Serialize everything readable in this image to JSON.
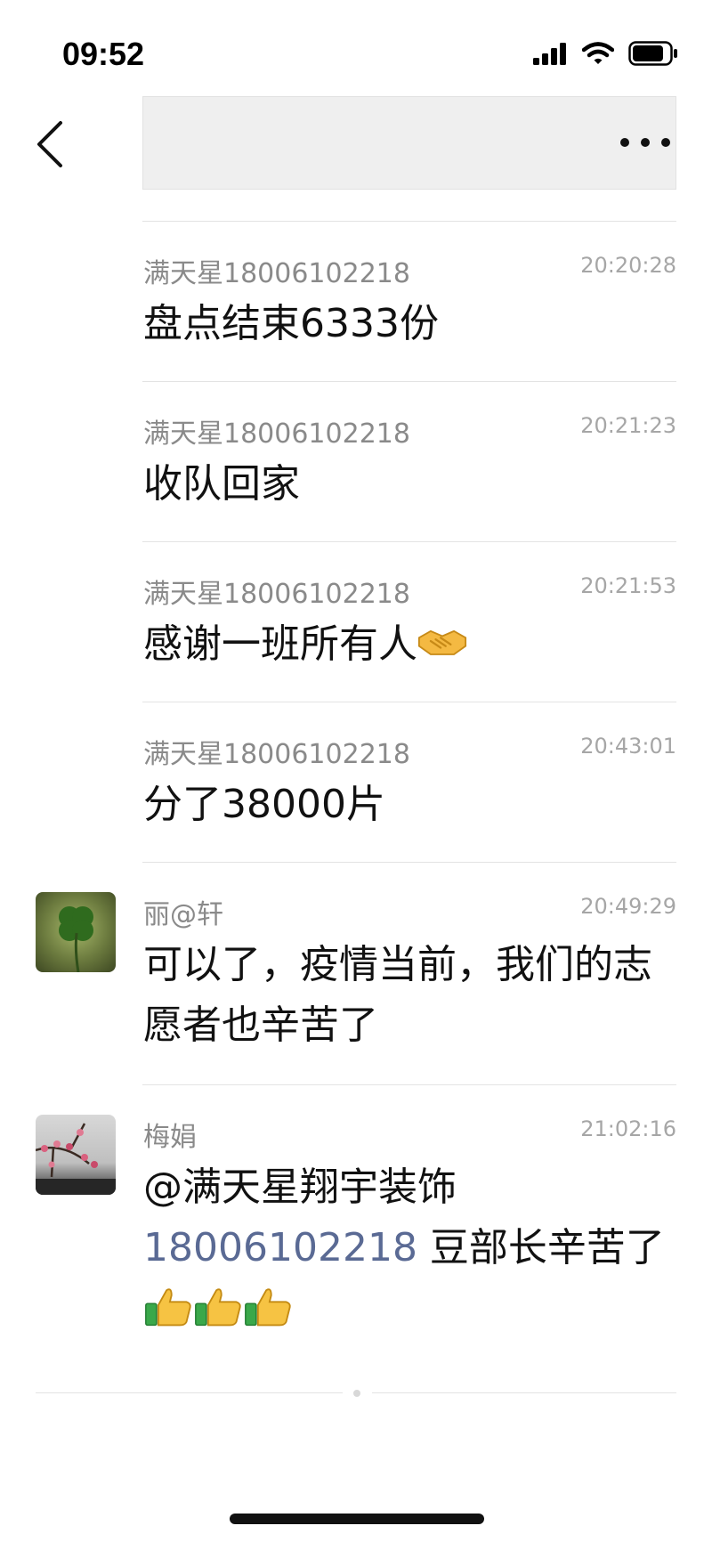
{
  "status_bar": {
    "time": "09:52",
    "battery_level": 0.85
  },
  "header": {
    "back_icon": "chevron-left-icon",
    "more_icon": "ellipsis-icon"
  },
  "messages": [
    {
      "sender": "满天星18006102218",
      "time": "20:20:28",
      "text": "盘点结束6333份"
    },
    {
      "sender": "满天星18006102218",
      "time": "20:21:23",
      "text": "收队回家"
    },
    {
      "sender": "满天星18006102218",
      "time": "20:21:53",
      "text": "感谢一班所有人",
      "emoji": "handshake-emoji"
    },
    {
      "sender": "满天星18006102218",
      "time": "20:43:01",
      "text": "分了38000片"
    },
    {
      "sender": "丽@轩",
      "time": "20:49:29",
      "text": "可以了，疫情当前，我们的志愿者也辛苦了",
      "avatar": "clover-avatar"
    },
    {
      "sender": "梅娟",
      "time": "21:02:16",
      "avatar": "plum-blossom-avatar",
      "text_prefix": "@满天星翔宇装饰",
      "mention_number": "18006102218",
      "text_suffix": " 豆部长辛苦了",
      "emoji": "thumbs-up-emoji",
      "emoji_count": 3
    }
  ]
}
